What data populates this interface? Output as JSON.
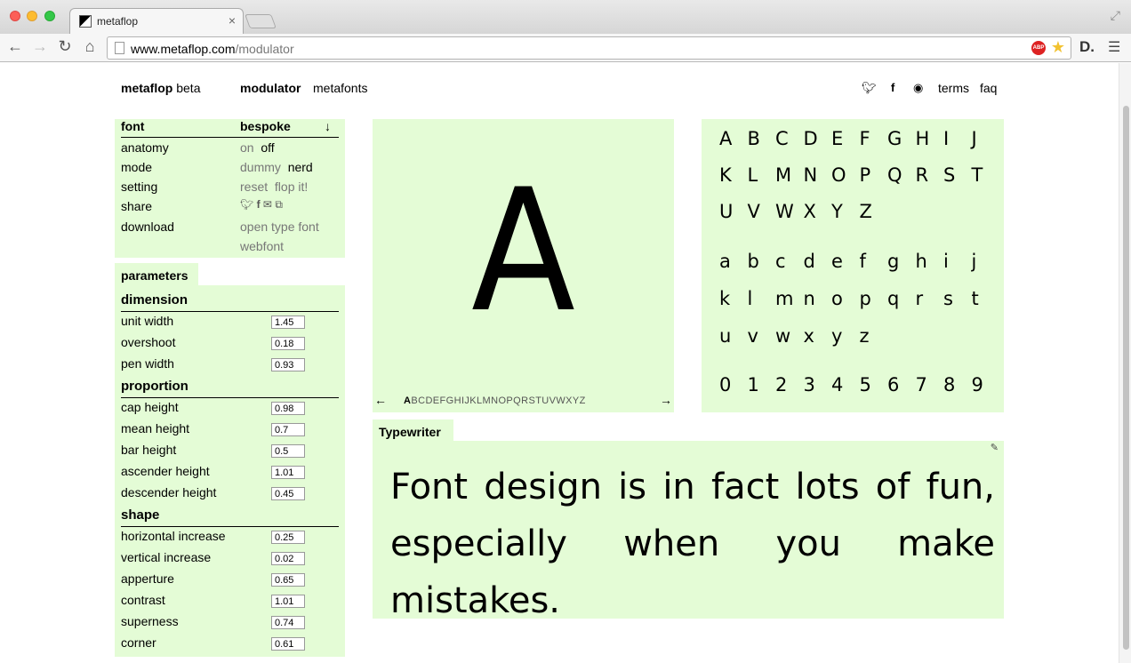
{
  "browser": {
    "tab_title": "metaflop",
    "url_host": "www.metaflop.com",
    "url_path": "/modulator"
  },
  "header": {
    "logo_bold": "metaflop",
    "logo_suffix": " beta",
    "nav_modulator": "modulator",
    "nav_metafonts": "metafonts",
    "terms": "terms",
    "faq": "faq"
  },
  "font_panel": {
    "title": "font",
    "font_name": "bespoke",
    "down_arrow": "↓",
    "anatomy_label": "anatomy",
    "anatomy_on": "on",
    "anatomy_off": "off",
    "mode_label": "mode",
    "mode_dummy": "dummy",
    "mode_nerd": "nerd",
    "setting_label": "setting",
    "setting_reset": "reset",
    "setting_flop": "flop it!",
    "share_label": "share",
    "download_label": "download",
    "download_otf": "open type font",
    "download_web": "webfont"
  },
  "parameters": {
    "tab": "parameters",
    "dimension_title": "dimension",
    "dimension": [
      {
        "label": "unit width",
        "value": "1.45"
      },
      {
        "label": "overshoot",
        "value": "0.18"
      },
      {
        "label": "pen width",
        "value": "0.93"
      }
    ],
    "proportion_title": "proportion",
    "proportion": [
      {
        "label": "cap height",
        "value": "0.98"
      },
      {
        "label": "mean height",
        "value": "0.7"
      },
      {
        "label": "bar height",
        "value": "0.5"
      },
      {
        "label": "ascender height",
        "value": "1.01"
      },
      {
        "label": "descender height",
        "value": "0.45"
      }
    ],
    "shape_title": "shape",
    "shape": [
      {
        "label": "horizontal increase",
        "value": "0.25"
      },
      {
        "label": "vertical increase",
        "value": "0.02"
      },
      {
        "label": "apperture",
        "value": "0.65"
      },
      {
        "label": "contrast",
        "value": "1.01"
      },
      {
        "label": "superness",
        "value": "0.74"
      },
      {
        "label": "corner",
        "value": "0.61"
      }
    ]
  },
  "glyph_preview": {
    "glyph": "A",
    "prev_arrow": "←",
    "next_arrow": "→",
    "current": "A",
    "rest": "BCDEFGHIJKLMNOPQRSTUVWXYZ"
  },
  "char_chart": {
    "upper1": [
      "A",
      "B",
      "C",
      "D",
      "E",
      "F",
      "G",
      "H",
      "I",
      "J"
    ],
    "upper2": [
      "K",
      "L",
      "M",
      "N",
      "O",
      "P",
      "Q",
      "R",
      "S",
      "T"
    ],
    "upper3": [
      "U",
      "V",
      "W",
      "X",
      "Y",
      "Z"
    ],
    "lower1": [
      "a",
      "b",
      "c",
      "d",
      "e",
      "f",
      "g",
      "h",
      "i",
      "j"
    ],
    "lower2": [
      "k",
      "l",
      "m",
      "n",
      "o",
      "p",
      "q",
      "r",
      "s",
      "t"
    ],
    "lower3": [
      "u",
      "v",
      "w",
      "x",
      "y",
      "z"
    ],
    "digits": [
      "0",
      "1",
      "2",
      "3",
      "4",
      "5",
      "6",
      "7",
      "8",
      "9"
    ]
  },
  "typewriter": {
    "tab": "Typewriter",
    "text": "Font design is in fact lots of fun, especially when you make mistakes."
  }
}
